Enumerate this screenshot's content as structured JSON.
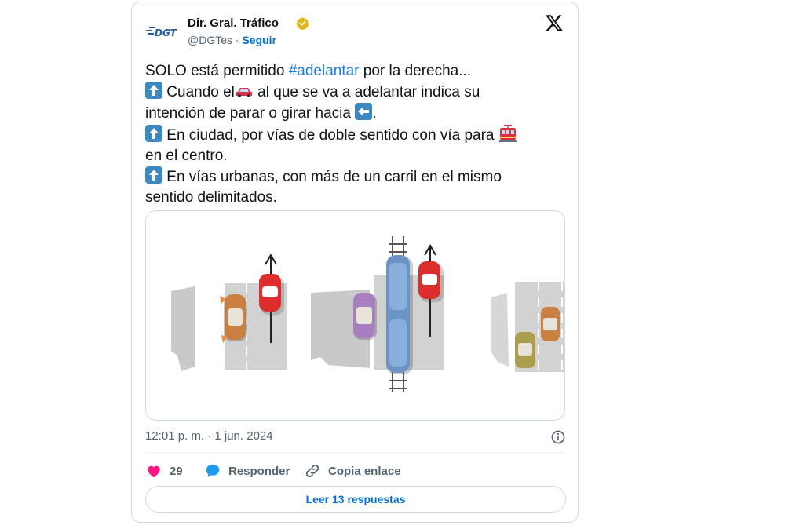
{
  "author": {
    "name": "Dir. Gral. Tráfico",
    "handle": "@DGTes",
    "separator": " · ",
    "follow_label": "Seguir",
    "logo_text": "DGT"
  },
  "tweet": {
    "line1_a": "SOLO está permitido ",
    "hashtag": "#adelantar",
    "line1_b": " por la derecha...",
    "line2_a": " Cuando el",
    "line2_b": " al que se va a adelantar indica su",
    "line3": "intención de parar o girar hacia ",
    "line3_end": ".",
    "line4": " En ciudad, por vías de doble sentido con vía para ",
    "line5": "en el centro.",
    "line6": " En vías urbanas, con más de un carril en el mismo",
    "line7": "sentido delimitados."
  },
  "icons": {
    "close": "x-logo-icon",
    "verified": "verified-badge-icon",
    "info": "info-icon",
    "like": "heart-icon",
    "reply": "reply-bubble-icon",
    "link": "link-icon",
    "arrow_up": "arrow-up-emoji",
    "arrow_left": "arrow-left-emoji",
    "car": "red-car-emoji",
    "tram": "tram-emoji"
  },
  "timestamp": "12:01 p. m. · 1 jun. 2024",
  "actions": {
    "likes": "29",
    "reply_label": "Responder",
    "copy_label": "Copia enlace"
  },
  "replies_button": "Leer 13 respuestas",
  "colors": {
    "link_blue": "#006fd6",
    "hashtag_blue": "#1d7bd8",
    "heart_pink": "#f91880",
    "badge_gold": "#e2b719",
    "emoji_blue": "#3b88c3"
  }
}
